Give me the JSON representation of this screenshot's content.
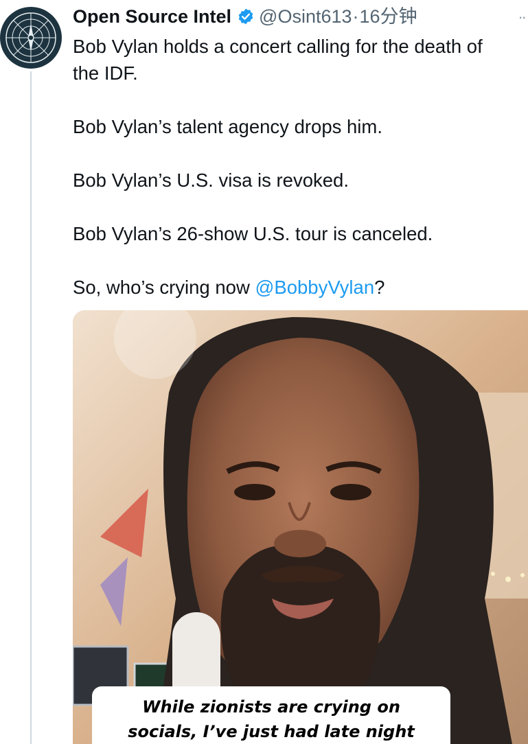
{
  "header": {
    "display_name": "Open Source Intel",
    "handle": "@Osint613",
    "separator": "·",
    "time": "16分钟",
    "more": "··"
  },
  "avatar": {
    "icon": "compass-logo-icon",
    "colors": {
      "bg": "#1d3440",
      "ring": "#e7eef1"
    }
  },
  "tweet": {
    "lines": [
      "Bob Vylan holds a concert calling for the death of",
      "the IDF.",
      "",
      "Bob Vylan’s talent agency drops him.",
      "",
      "Bob Vylan’s U.S. visa is revoked.",
      "",
      "Bob Vylan’s 26-show U.S. tour is canceled.",
      "",
      "So, who’s crying now "
    ],
    "mention": "@BobbyVylan",
    "end_punct": "?"
  },
  "media": {
    "caption_line1": "While zionists are crying on",
    "caption_line2": "socials, I’ve just had late night"
  },
  "colors": {
    "accent": "#1d9bf0",
    "text": "#0f1419",
    "muted": "#536471"
  }
}
